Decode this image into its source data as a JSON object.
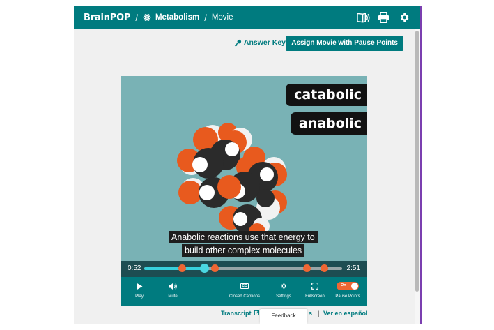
{
  "header": {
    "logo": "BrainPOP",
    "separator": "/",
    "topic": "Metabolism",
    "page": "Movie",
    "icons": [
      "read-aloud-icon",
      "print-icon",
      "settings-gear-icon"
    ]
  },
  "toolbar": {
    "answer_key": "Answer Key",
    "assign_button": "Assign Movie with Pause Points"
  },
  "video": {
    "terms": [
      "catabolic",
      "anabolic"
    ],
    "caption_line1": "Anabolic reactions use that energy to",
    "caption_line2": "build other complex molecules"
  },
  "timeline": {
    "current": "0:52",
    "total": "2:51",
    "progress_fraction": 0.304,
    "pause_points_fraction": [
      0.19,
      0.355,
      0.82,
      0.91
    ]
  },
  "controls": {
    "play": "Play",
    "mute": "Mute",
    "closed_captions": "Closed Captions",
    "cc_glyph": "CC",
    "settings": "Settings",
    "fullscreen": "Fullscreen",
    "pause_points": "Pause Points",
    "pause_points_state": "On"
  },
  "footer": {
    "transcript": "Transcript",
    "visible_partial": "s",
    "divider": "|",
    "spanish": "Ver en español",
    "feedback": "Feedback"
  },
  "colors": {
    "teal": "#007b7f",
    "dark_teal": "#1d4d52",
    "orange": "#ee6633",
    "video_bg": "#79b2b5"
  }
}
